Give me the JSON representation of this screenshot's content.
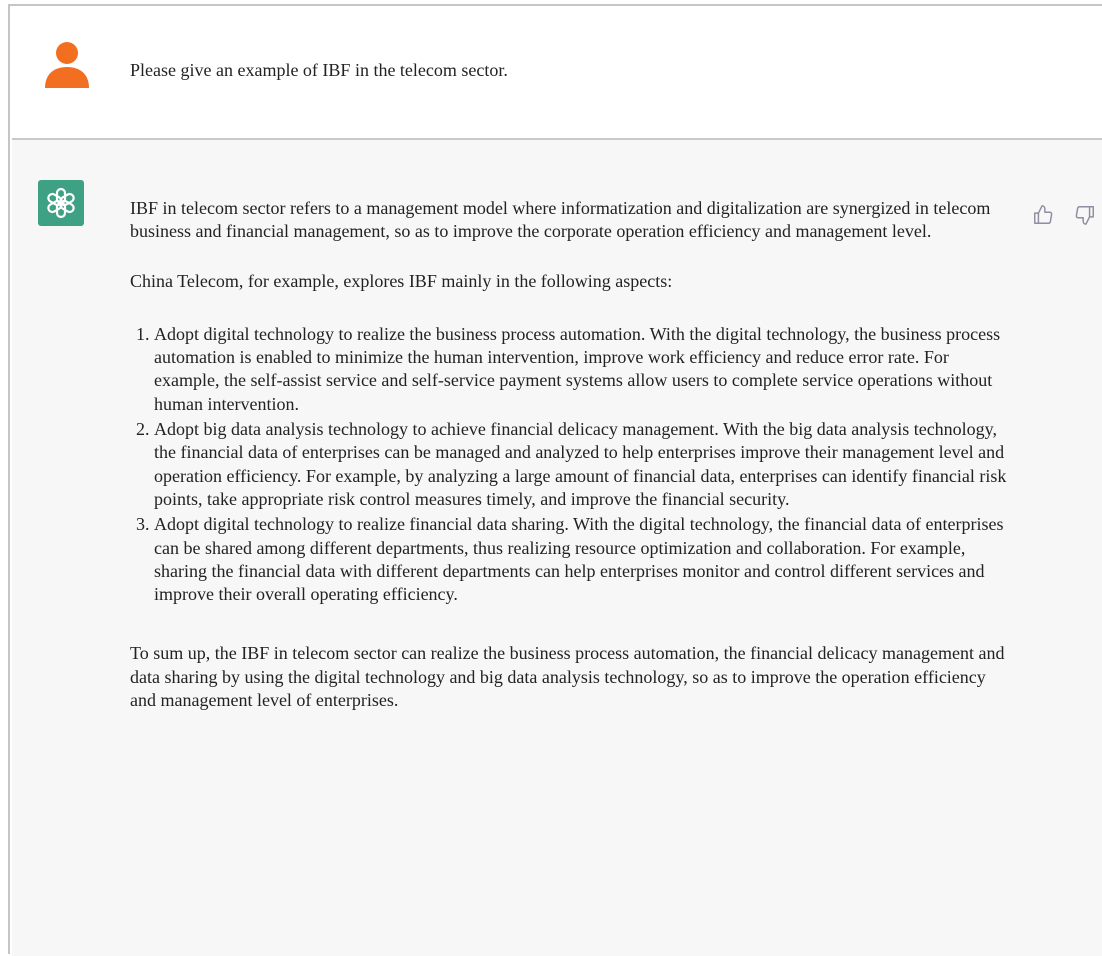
{
  "user_message": {
    "text": "Please give an example of IBF in the telecom sector."
  },
  "assistant_message": {
    "intro": "IBF in telecom sector refers to a management model where informatization and digitalization are synergized in telecom business and financial management, so as to improve the corporate operation efficiency and management level.",
    "lead": "China Telecom, for example, explores IBF mainly in the following aspects:",
    "items": [
      "Adopt digital technology to realize the business process automation. With the digital technology, the business process automation is enabled to minimize the human intervention, improve work efficiency and reduce error rate. For example, the self-assist service and self-service payment systems allow users to complete service operations without human intervention.",
      "Adopt big data analysis technology to achieve financial delicacy management. With the big data analysis technology, the financial data of enterprises can be managed and analyzed to help enterprises improve their management level and operation efficiency. For example, by analyzing a large amount of financial data, enterprises can identify financial risk points, take appropriate risk control measures timely, and improve the financial security.",
      "Adopt digital technology to realize financial data sharing. With the digital technology, the financial data of enterprises can be shared among different departments, thus realizing resource optimization and collaboration. For example, sharing the financial data with different departments can help enterprises monitor and control different services and improve their overall operating efficiency."
    ],
    "summary": "To sum up, the IBF in telecom sector can realize the business process automation, the financial delicacy management and data sharing by using the digital technology and big data analysis technology, so as to improve the operation efficiency and management level of enterprises."
  },
  "icons": {
    "user_avatar": "person-icon",
    "assistant_avatar": "openai-logo-icon",
    "like": "thumbs-up-icon",
    "dislike": "thumbs-down-icon"
  },
  "colors": {
    "user_avatar": "#f26f21",
    "assistant_avatar_bg": "#3fa184",
    "assistant_row_bg": "#f7f7f8",
    "divider": "#c9c9c9"
  }
}
